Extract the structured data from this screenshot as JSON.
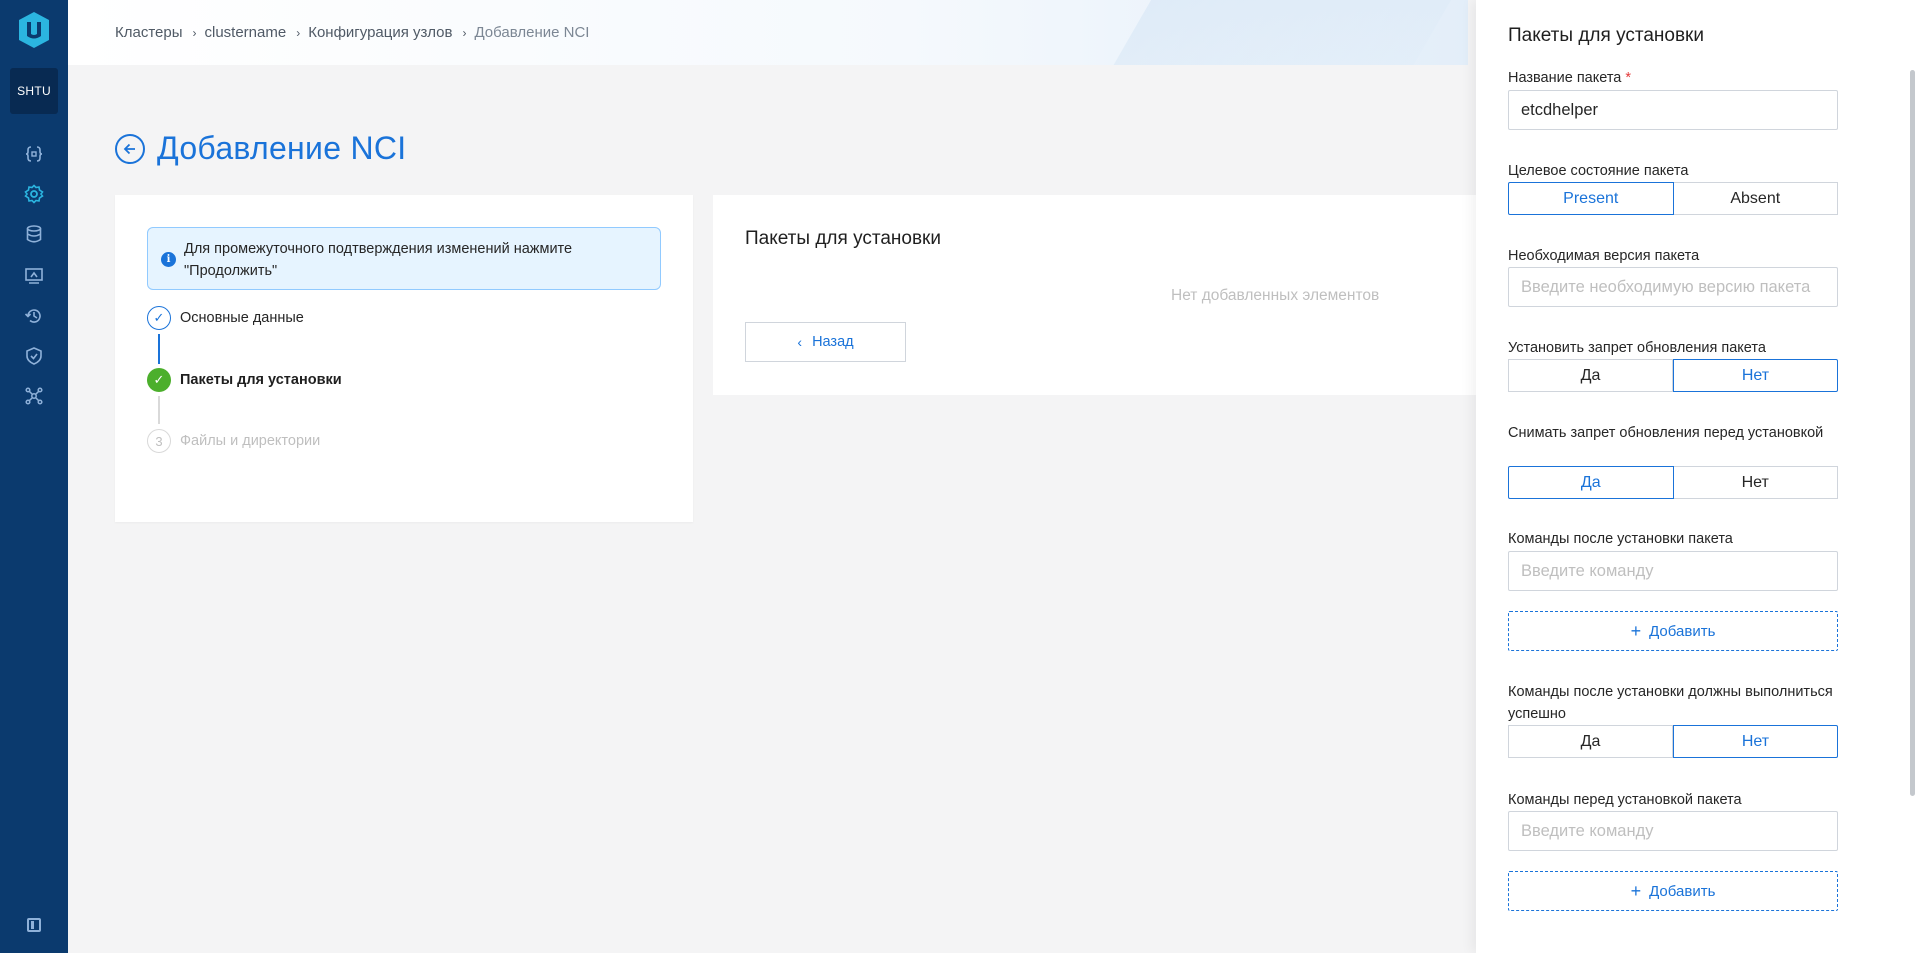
{
  "sidebar": {
    "cluster_badge": "SHTU",
    "icons": [
      "braces-icon",
      "gear-icon",
      "database-icon",
      "monitor-icon",
      "history-icon",
      "shield-icon",
      "network-icon"
    ],
    "brand_color": "#0b3a6e"
  },
  "breadcrumb": {
    "items": [
      "Кластеры",
      "clustername",
      "Конфигурация узлов",
      "Добавление NCI"
    ]
  },
  "page": {
    "title": "Добавление NCI"
  },
  "steps": {
    "info": "Для промежуточного подтверждения изменений нажмите \"Продолжить\"",
    "items": [
      {
        "label": "Основные данные",
        "state": "done",
        "marker": "✓"
      },
      {
        "label": "Пакеты для установки",
        "state": "current",
        "marker": "✓"
      },
      {
        "label": "Файлы и директории",
        "state": "pending",
        "marker": "3"
      }
    ]
  },
  "packages_card": {
    "title": "Пакеты для установки",
    "empty_text": "Нет добавленных элементов",
    "back_label": "Назад"
  },
  "drawer": {
    "title": "Пакеты для установки",
    "package_name": {
      "label": "Название пакета",
      "required_mark": "*",
      "value": "etcdhelper"
    },
    "target_state": {
      "label": "Целевое состояние пакета",
      "options": [
        "Present",
        "Absent"
      ],
      "selected": "Present"
    },
    "required_version": {
      "label": "Необходимая версия пакета",
      "placeholder": "Введите необходимую версию пакета"
    },
    "hold_update": {
      "label": "Установить запрет обновления пакета",
      "options": [
        "Да",
        "Нет"
      ],
      "selected": "Нет"
    },
    "unhold_before": {
      "label": "Снимать запрет обновления перед установкой",
      "options": [
        "Да",
        "Нет"
      ],
      "selected": "Да"
    },
    "post_commands": {
      "label": "Команды после установки пакета",
      "placeholder": "Введите команду",
      "add_label": "Добавить"
    },
    "post_must_succeed": {
      "label": "Команды после установки должны выполниться успешно",
      "options": [
        "Да",
        "Нет"
      ],
      "selected": "Нет"
    },
    "pre_commands": {
      "label": "Команды перед установкой пакета",
      "placeholder": "Введите команду",
      "add_label": "Добавить"
    }
  },
  "colors": {
    "accent": "#1a73d9",
    "success": "#4caf2c",
    "required": "#e23a3a"
  }
}
